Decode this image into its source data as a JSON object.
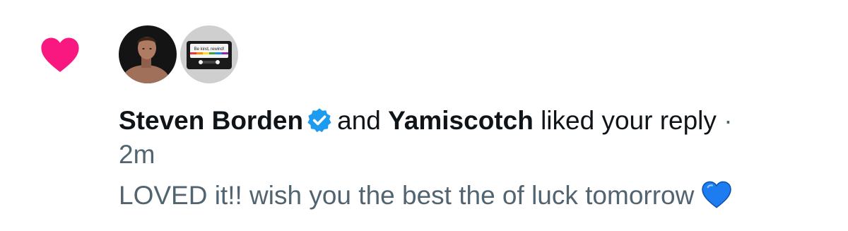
{
  "notification": {
    "type_icon": "heart-icon",
    "type_icon_color": "#f91880",
    "avatars": [
      {
        "name": "Steven Borden",
        "icon": "person-photo-avatar"
      },
      {
        "name": "Yamiscotch",
        "icon": "cassette-tape-avatar",
        "cassette_label": "Be kind, rewind!"
      }
    ],
    "user1": "Steven Borden",
    "verified_icon": "verified-badge-icon",
    "verified_color": "#1d9bf0",
    "connector": "and",
    "user2": "Yamiscotch",
    "action": "liked your reply",
    "separator": "·",
    "time": "2m",
    "reply_text": "LOVED it!! wish you the best the of luck tomorrow",
    "reply_emoji": "blue-heart-icon",
    "reply_emoji_color": "#1d7cf0"
  }
}
